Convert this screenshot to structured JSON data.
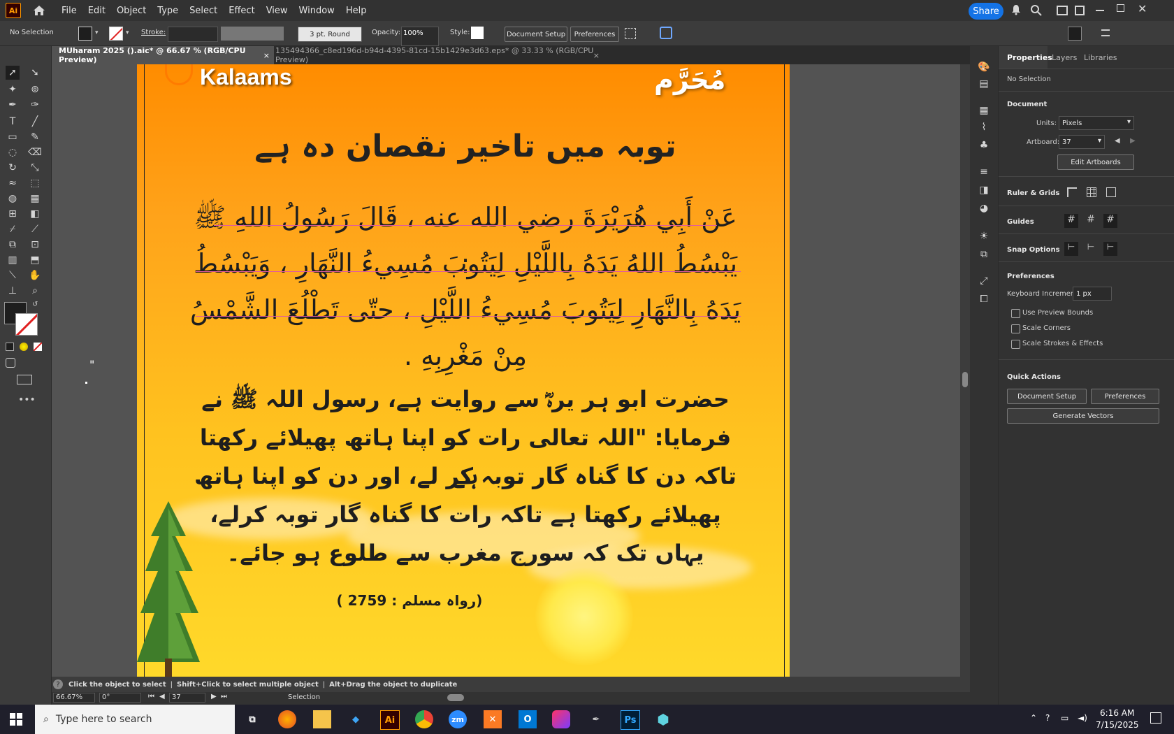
{
  "app": {
    "logo": "Ai"
  },
  "menu": [
    "File",
    "Edit",
    "Object",
    "Type",
    "Select",
    "Effect",
    "View",
    "Window",
    "Help"
  ],
  "share_label": "Share",
  "control_bar": {
    "selection": "No Selection",
    "stroke_label": "Stroke:",
    "brush": "3 pt. Round",
    "opacity_label": "Opacity:",
    "opacity_value": "100%",
    "style_label": "Style:",
    "document_setup": "Document Setup",
    "preferences": "Preferences"
  },
  "tabs": [
    {
      "label": "MUharam 2025 ().aic* @ 66.67 % (RGB/CPU Preview)",
      "close": "×"
    },
    {
      "label": "135494366_c8ed196d-b94d-4395-81cd-15b1429e3d63.eps* @ 33.33 % (RGB/CPU Preview)",
      "close": "×"
    }
  ],
  "artwork": {
    "logo_text": "Kalaams",
    "header_arabic": "مُحَرَّم",
    "title": "توبہ میں تاخیر نقصان دہ ہے",
    "arabic_lines": [
      "عَنْ أَبِي هُرَيْرَةَ رضي الله عنه ، قَالَ رَسُولُ اللهِ ﷺ :",
      "يَبْسُطُ اللهُ يَدَهُ بِاللَّيْلِ لِيَتُوبَ مُسِيءُ النَّهَارِ ، وَيَبْسُطُ",
      "يَدَهُ بِالنَّهَارِ لِيَتُوبَ مُسِيءُ اللَّيْلِ ، حتّى تَطْلُعَ الشَّمْسُ",
      "مِنْ مَغْرِبِهِ ."
    ],
    "urdu_lines": [
      "حضرت ابو ہر یرہؓ سے روایت ہے، رسول اللہ ﷺ نے",
      "فرمایا: \"اللہ تعالی رات کو اپنا ہاتھ پھیلائے رکھتا ہے",
      "تاکہ دن کا گناہ گار توبہ کر لے، اور دن کو اپنا ہاتھ",
      "پھیلائے رکھتا ہے تاکہ رات کا گناہ گار توبہ کرلے،",
      "یہاں تک کہ سورج مغرب سے طلوع ہو جائے۔"
    ],
    "reference": "(رواہ مسلم : 2759 )"
  },
  "properties": {
    "tabs": [
      "Properties",
      "Layers",
      "Libraries"
    ],
    "no_selection": "No Selection",
    "document": "Document",
    "units_label": "Units:",
    "units_value": "Pixels",
    "artboard_label": "Artboard:",
    "artboard_value": "37",
    "edit_artboards": "Edit Artboards",
    "rulers_grids": "Ruler & Grids",
    "guides": "Guides",
    "snap_options": "Snap Options",
    "preferences": "Preferences",
    "keyboard_increment_label": "Keyboard Increment:",
    "keyboard_increment_value": "1 px",
    "use_preview_bounds": "Use Preview Bounds",
    "scale_corners": "Scale Corners",
    "scale_strokes": "Scale Strokes & Effects",
    "quick_actions": "Quick Actions",
    "qa_document_setup": "Document Setup",
    "qa_preferences": "Preferences",
    "generate_vectors": "Generate Vectors"
  },
  "status": {
    "hint": "Click the object to select",
    "hint2": "Shift+Click to select multiple object",
    "hint3": "Alt+Drag the object to duplicate",
    "zoom": "66.67%",
    "rotate": "0°",
    "artboard_nav": "37",
    "tool": "Selection"
  },
  "taskbar": {
    "search_placeholder": "Type here to search",
    "time": "6:16 AM",
    "date": "7/15/2025",
    "apps": [
      "Ai",
      "zm",
      "Ps"
    ]
  }
}
